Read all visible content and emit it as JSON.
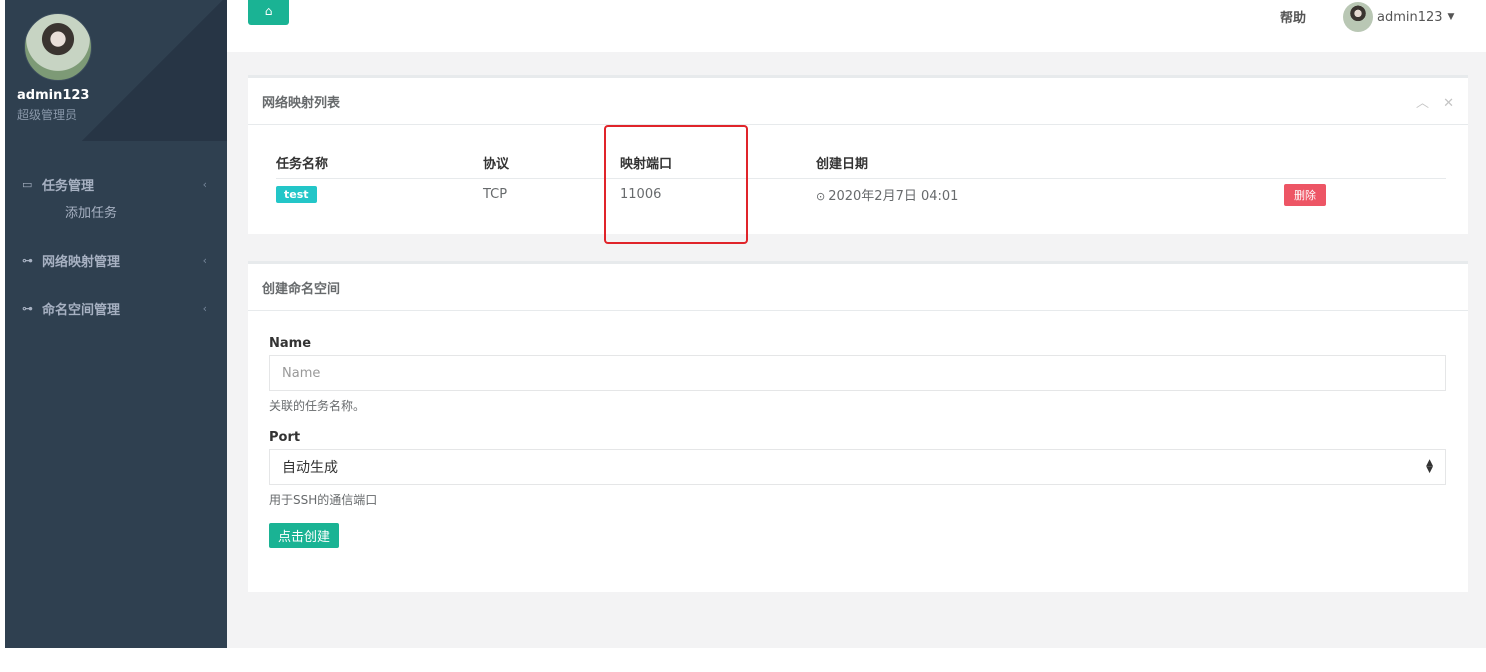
{
  "sidebar": {
    "user_name": "admin123",
    "user_role": "超级管理员",
    "menu": {
      "task": {
        "label": "任务管理",
        "icon": "computer-icon",
        "chevron": "‹"
      },
      "task_add": {
        "label": "添加任务"
      },
      "network": {
        "label": "网络映射管理",
        "icon": "plug-icon",
        "chevron": "‹"
      },
      "namespace": {
        "label": "命名空间管理",
        "icon": "plug-icon",
        "chevron": "‹"
      }
    }
  },
  "topbar": {
    "help": "帮助",
    "user": "admin123"
  },
  "mapping_box": {
    "title": "网络映射列表",
    "columns": [
      "任务名称",
      "协议",
      "映射端口",
      "创建日期"
    ],
    "rows": [
      {
        "name": "test",
        "protocol": "TCP",
        "port": "11006",
        "date": "2020年2月7日 04:01",
        "action": "删除"
      }
    ]
  },
  "namespace_form": {
    "title": "创建命名空间",
    "name_label": "Name",
    "name_placeholder": "Name",
    "name_help": "关联的任务名称。",
    "port_label": "Port",
    "port_value": "自动生成",
    "port_help": "用于SSH的通信端口",
    "submit": "点击创建"
  },
  "colors": {
    "primary": "#1ab394",
    "info": "#23c6c8",
    "danger": "#ed5565",
    "sidebar": "#2f4050",
    "highlight": "#e0242a"
  }
}
